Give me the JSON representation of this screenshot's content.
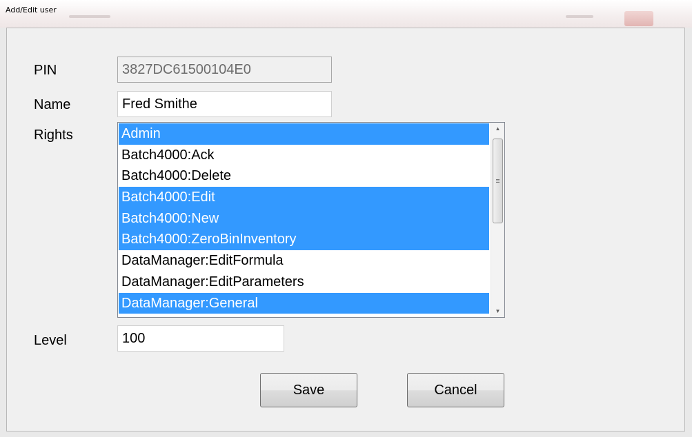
{
  "window": {
    "title": "Add/Edit user"
  },
  "form": {
    "pin": {
      "label": "PIN",
      "value": "3827DC61500104E0"
    },
    "name": {
      "label": "Name",
      "value": "Fred Smithe"
    },
    "rights": {
      "label": "Rights",
      "items": [
        {
          "label": "Admin",
          "selected": true
        },
        {
          "label": "Batch4000:Ack",
          "selected": false
        },
        {
          "label": "Batch4000:Delete",
          "selected": false
        },
        {
          "label": "Batch4000:Edit",
          "selected": true
        },
        {
          "label": "Batch4000:New",
          "selected": true
        },
        {
          "label": "Batch4000:ZeroBinInventory",
          "selected": true
        },
        {
          "label": "DataManager:EditFormula",
          "selected": false
        },
        {
          "label": "DataManager:EditParameters",
          "selected": false
        },
        {
          "label": "DataManager:General",
          "selected": true
        }
      ]
    },
    "level": {
      "label": "Level",
      "value": "100"
    }
  },
  "buttons": {
    "save": "Save",
    "cancel": "Cancel"
  },
  "colors": {
    "selection": "#3399ff",
    "dialog_bg": "#f0f0f0"
  }
}
